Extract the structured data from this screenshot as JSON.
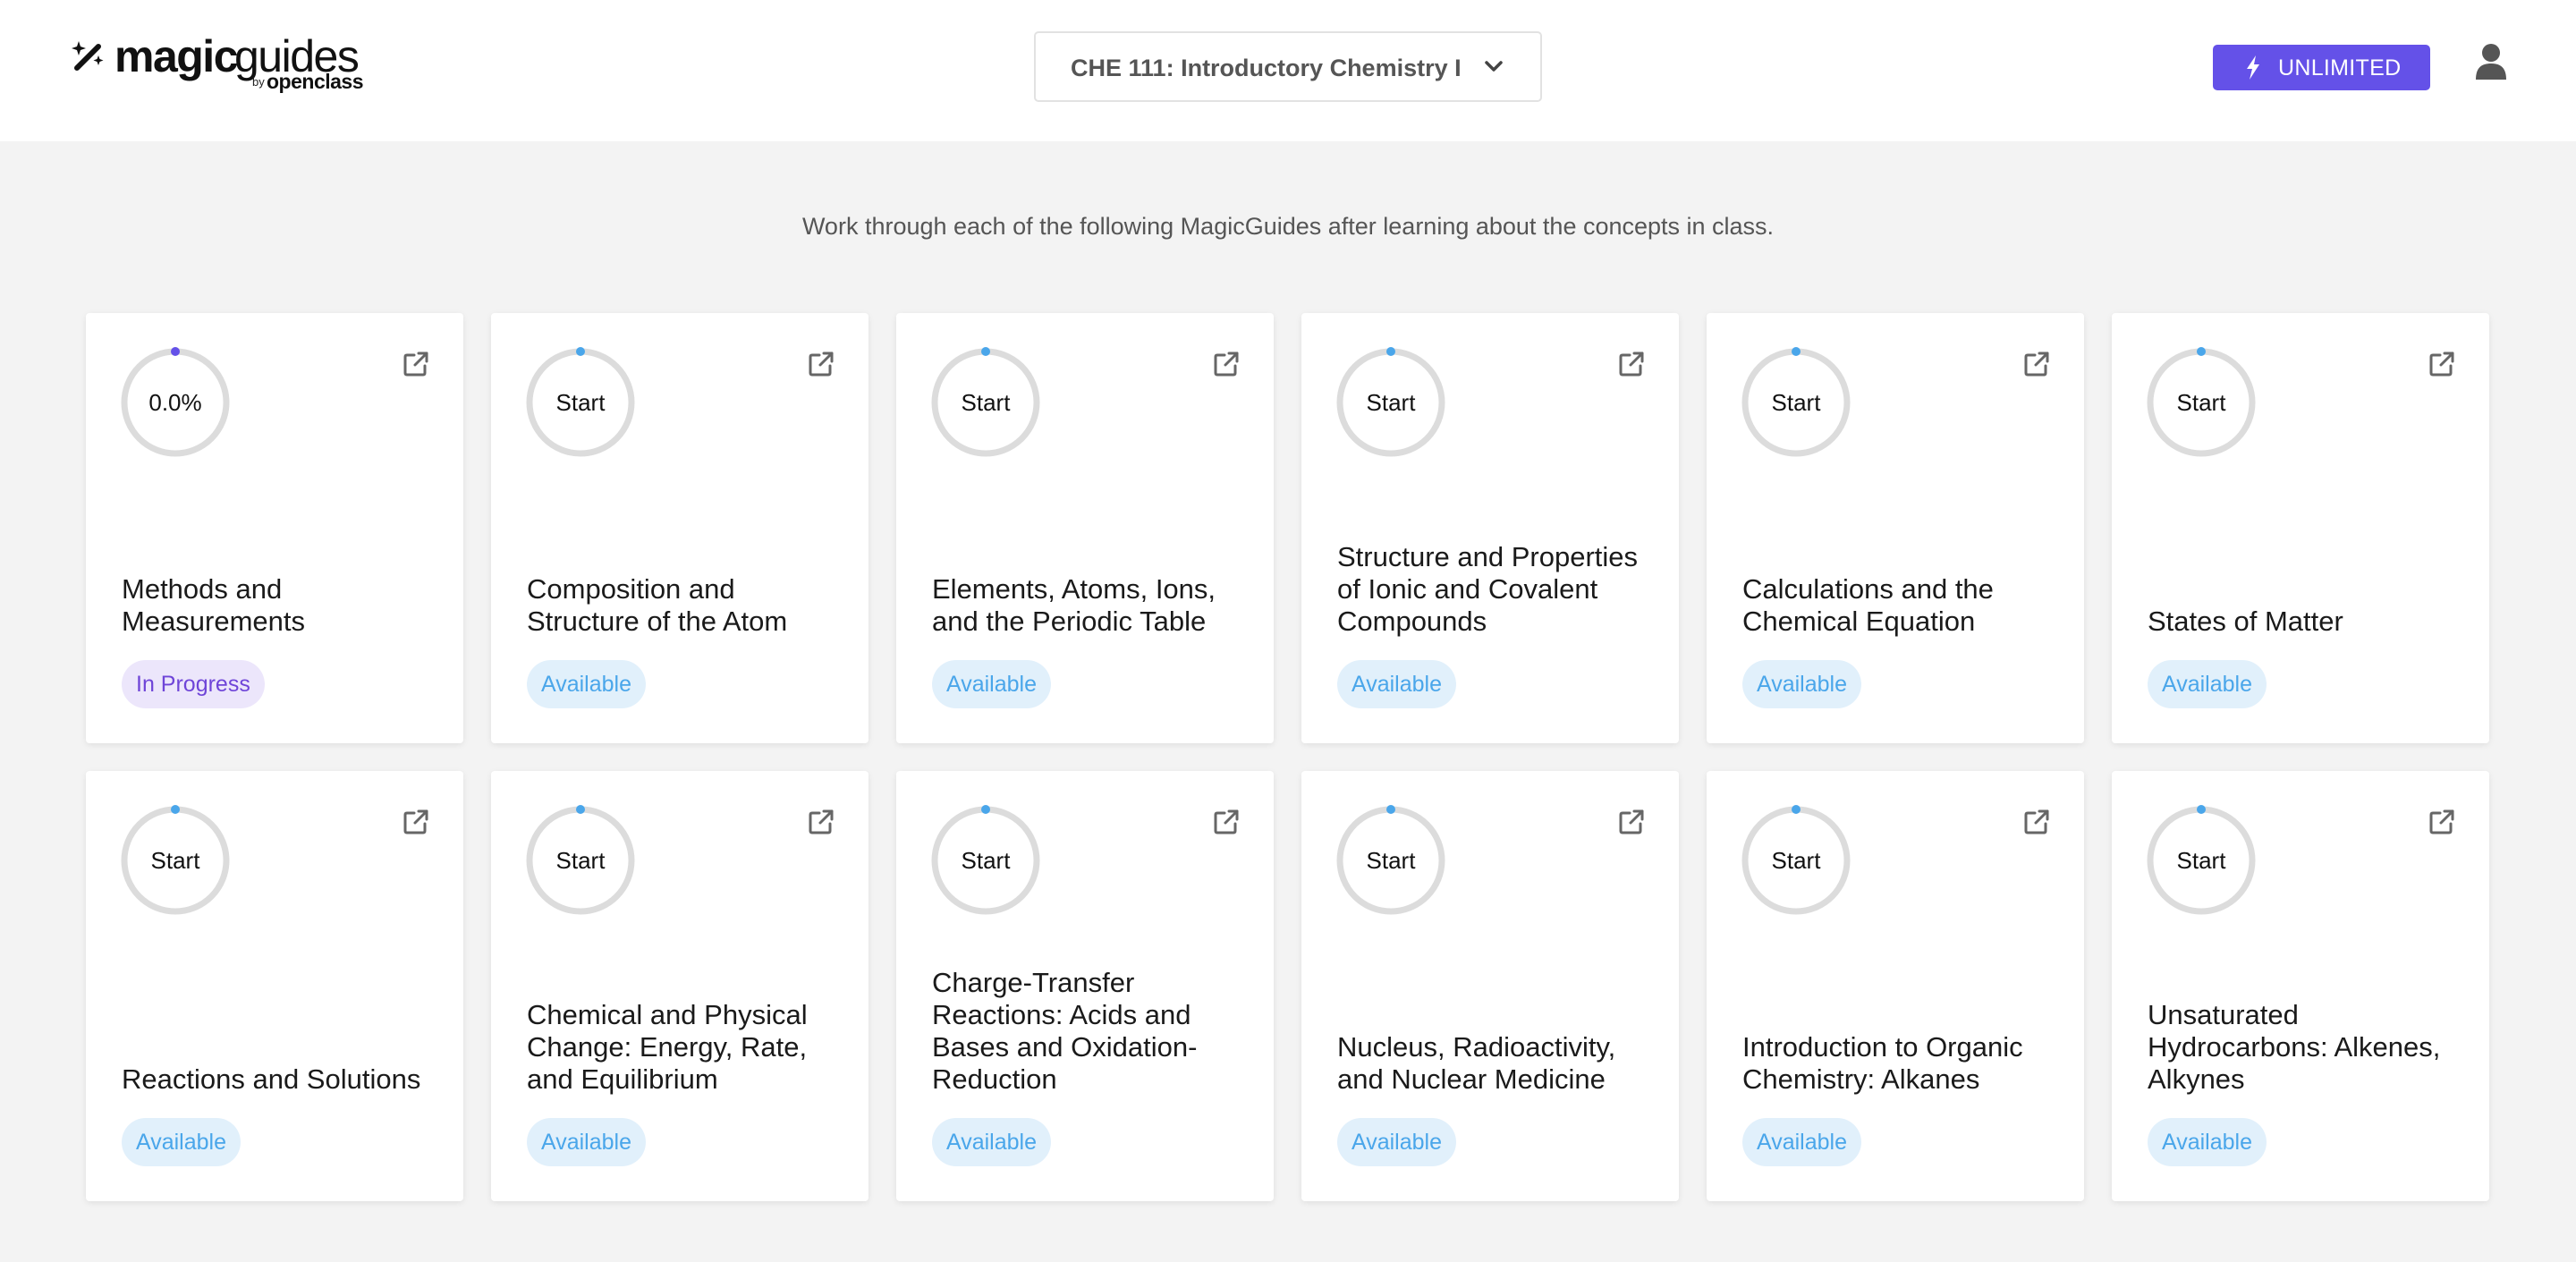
{
  "header": {
    "logo": {
      "magic": "magic",
      "guides": "guides",
      "by": "by",
      "openclass": "openclass"
    },
    "course_select": {
      "label": "CHE 111: Introductory Chemistry I",
      "icon": "chevron-down-icon"
    },
    "plan_button": {
      "label": "UNLIMITED",
      "icon": "bolt-icon"
    },
    "user_icon": "user-icon"
  },
  "intro": "Work through each of the following MagicGuides after learning about the concepts in class.",
  "colors": {
    "accent": "#6451e8",
    "available_bg": "#e1f0fb",
    "available_text": "#4aa6ea",
    "in_progress_bg": "#ece6fb",
    "in_progress_text": "#6f45d8",
    "ring_track": "#dcdcdc"
  },
  "guides": [
    {
      "ring": "0.0%",
      "progress": 0.0,
      "title": "Methods and Measurements",
      "status": "In Progress"
    },
    {
      "ring": "Start",
      "progress": 0.0,
      "title": "Composition and Structure of the Atom",
      "status": "Available"
    },
    {
      "ring": "Start",
      "progress": 0.0,
      "title": "Elements, Atoms, Ions, and the Periodic Table",
      "status": "Available"
    },
    {
      "ring": "Start",
      "progress": 0.0,
      "title": "Structure and Properties of Ionic and Covalent Compounds",
      "status": "Available"
    },
    {
      "ring": "Start",
      "progress": 0.0,
      "title": "Calculations and the Chemical Equation",
      "status": "Available"
    },
    {
      "ring": "Start",
      "progress": 0.0,
      "title": "States of Matter",
      "status": "Available"
    },
    {
      "ring": "Start",
      "progress": 0.0,
      "title": "Reactions and Solutions",
      "status": "Available"
    },
    {
      "ring": "Start",
      "progress": 0.0,
      "title": "Chemical and Physical Change: Energy, Rate, and Equilibrium",
      "status": "Available"
    },
    {
      "ring": "Start",
      "progress": 0.0,
      "title": "Charge-Transfer Reactions: Acids and Bases and Oxidation-Reduction",
      "status": "Available"
    },
    {
      "ring": "Start",
      "progress": 0.0,
      "title": "Nucleus, Radioactivity, and Nuclear Medicine",
      "status": "Available"
    },
    {
      "ring": "Start",
      "progress": 0.0,
      "title": "Introduction to Organic Chemistry: Alkanes",
      "status": "Available"
    },
    {
      "ring": "Start",
      "progress": 0.0,
      "title": "Unsaturated Hydrocarbons: Alkenes, Alkynes",
      "status": "Available"
    }
  ]
}
